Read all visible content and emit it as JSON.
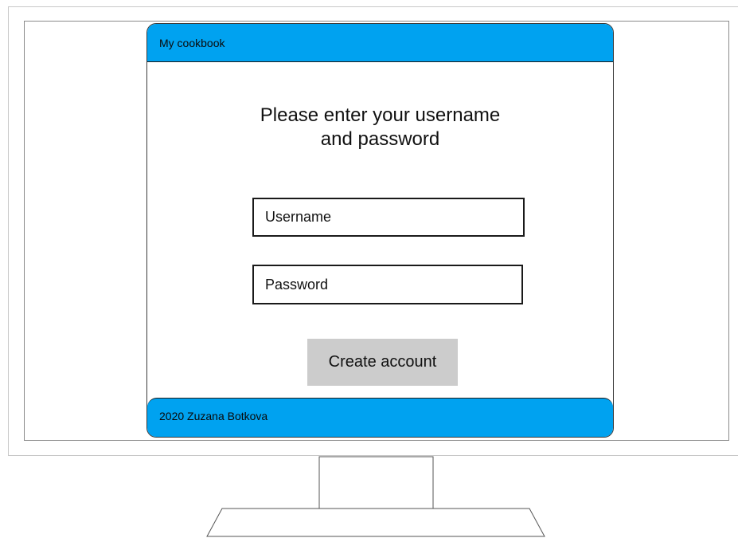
{
  "app": {
    "title": "My cookbook"
  },
  "login": {
    "prompt_line1": "Please enter your username",
    "prompt_line2": "and password",
    "username_placeholder": "Username",
    "password_placeholder": "Password",
    "create_account_label": "Create account"
  },
  "footer": {
    "text": "2020 Zuzana Botkova"
  },
  "colors": {
    "header_bg": "#00a2f0",
    "footer_bg": "#00a2f0",
    "button_bg": "#cccccc"
  }
}
